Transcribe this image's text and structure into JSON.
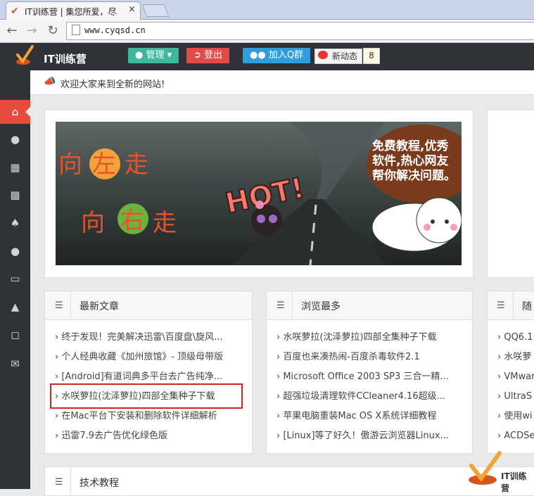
{
  "browser": {
    "tab_title": "IT训练营 | 集您所爱，尽",
    "tab_close": "×",
    "url": "www.cyqsd.cn"
  },
  "header": {
    "site_name": "IT训练营",
    "manage_label": "管理",
    "logout_label": "登出",
    "join_qq_label": "加入Q群",
    "weibo_label": "新动态",
    "weibo_count": "8"
  },
  "notice": {
    "text": "欢迎大家来到全新的网站!"
  },
  "banner": {
    "slogan_line1": "免费教程,优秀",
    "slogan_line2": "软件,热心网友",
    "slogan_line3": "帮你解决问题。",
    "sign_text": "HOT!",
    "left_text_1a": "向",
    "left_text_1b": "左",
    "left_text_1c": "走",
    "left_text_2a": "向",
    "left_text_2b": "右",
    "left_text_2c": "走"
  },
  "panels": {
    "latest": {
      "title": "最新文章",
      "items": [
        "终于发现！完美解决迅雷\\百度盘\\旋风...",
        "个人经典收藏《加州旅馆》- 顶级母带版",
        "[Android]有道词典多平台去广告纯净...",
        "水咲萝拉(沈泽萝拉)四部全集种子下载",
        "在Mac平台下安装和删除软件详细解析",
        "迅雷7.9去广告优化绿色版"
      ]
    },
    "popular": {
      "title": "浏览最多",
      "items": [
        "水咲萝拉(沈泽萝拉)四部全集种子下载",
        "百度也来凑热闹-百度杀毒软件2.1",
        "Microsoft Office 2003 SP3 三合一精...",
        "超强垃圾清理软件CCleaner4.16超级...",
        "苹果电脑重装Mac OS X系统详细教程",
        "[Linux]等了好久！傲游云浏览器Linux..."
      ]
    },
    "random": {
      "title": "随",
      "items": [
        "QQ6.1",
        "水咲萝",
        "VMwar",
        "UltraS",
        "使用wi",
        "ACDSe"
      ]
    },
    "tech": {
      "title": "技术教程"
    }
  },
  "watermark": {
    "text": "IT训练营"
  },
  "colors": {
    "header_bg": "#2f3237",
    "home_active": "#e74b3b",
    "manage_btn": "#3db89c",
    "logout_btn": "#e14b48",
    "qq_btn": "#2e9ede",
    "highlight": "#c62828"
  }
}
